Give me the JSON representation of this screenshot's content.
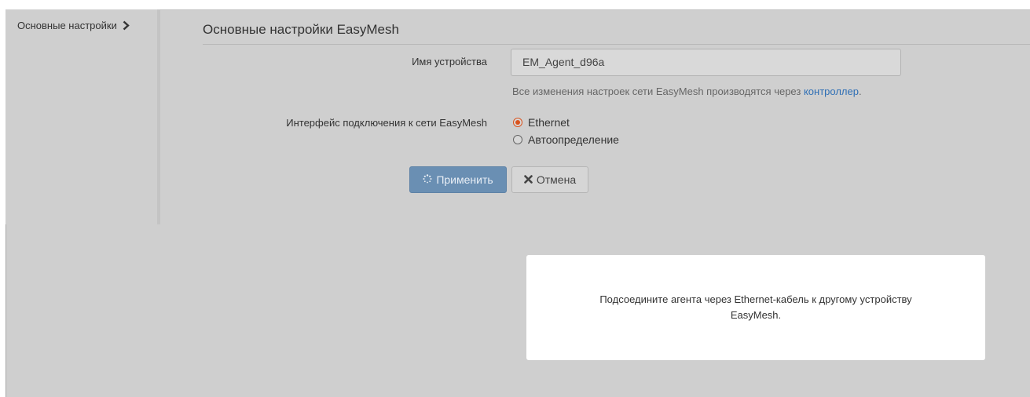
{
  "sidebar": {
    "items": [
      {
        "label": "Основные настройки",
        "icon": "chevron-right-icon"
      }
    ]
  },
  "main": {
    "title": "Основные настройки EasyMesh",
    "device_name": {
      "label": "Имя устройства",
      "value": "EM_Agent_d96a"
    },
    "help": {
      "text": "Все изменения настроек сети EasyMesh производятся через",
      "link": "контроллер",
      "suffix": "."
    },
    "interface": {
      "label": "Интерфейс подключения к сети EasyMesh",
      "options": [
        {
          "label": "Ethernet",
          "checked": true
        },
        {
          "label": "Автоопределение",
          "checked": false
        }
      ]
    },
    "buttons": {
      "apply": "Применить",
      "cancel": "Отмена"
    }
  },
  "notice": {
    "text": "Подсоедините агента через Ethernet-кабель к другому устройству EasyMesh."
  },
  "colors": {
    "overlay": "#cfcfcf",
    "primary_button": "#6a8fb3",
    "radio_accent": "#d9531e",
    "link": "#2f6fb5"
  }
}
